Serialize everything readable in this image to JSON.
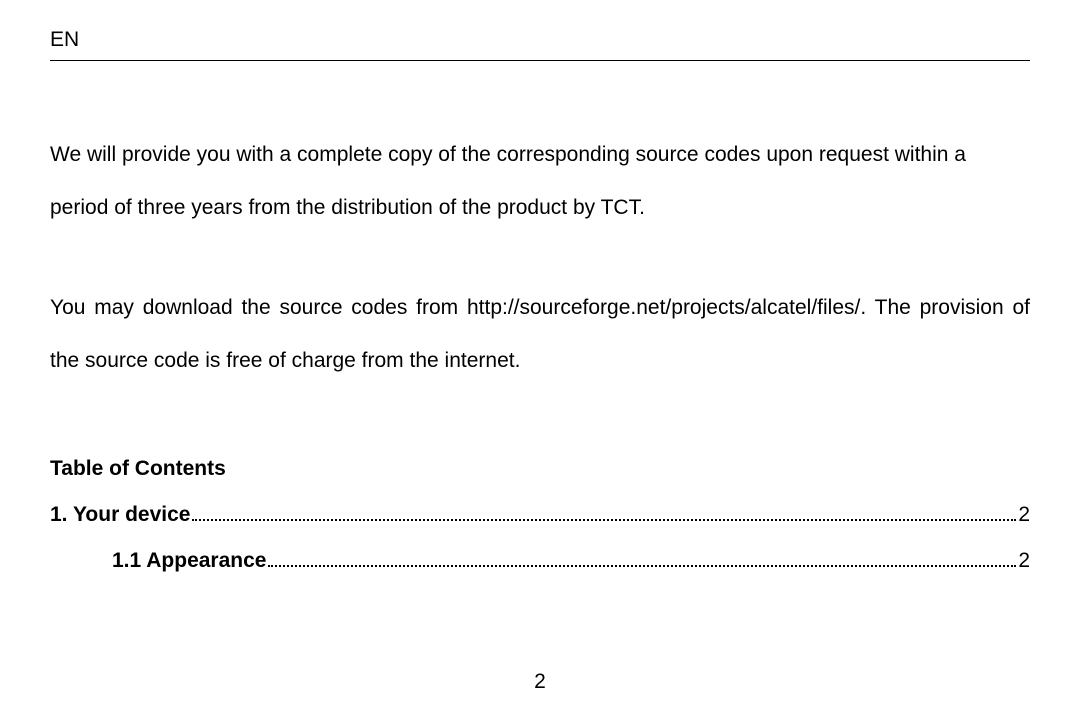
{
  "header": {
    "lang": "EN"
  },
  "paragraphs": {
    "p1": "We will provide you with a complete copy of the corresponding source codes upon request within a period of three years from the distribution of the product by TCT.",
    "p2": "You may download the source codes from http://sourceforge.net/projects/alcatel/files/. The provision of the source code is free of charge from the internet."
  },
  "toc": {
    "title": "Table of Contents",
    "entries": [
      {
        "label": "1. Your device",
        "page": "2"
      },
      {
        "label": "1.1 Appearance",
        "page": "2"
      }
    ]
  },
  "page_number": "2"
}
